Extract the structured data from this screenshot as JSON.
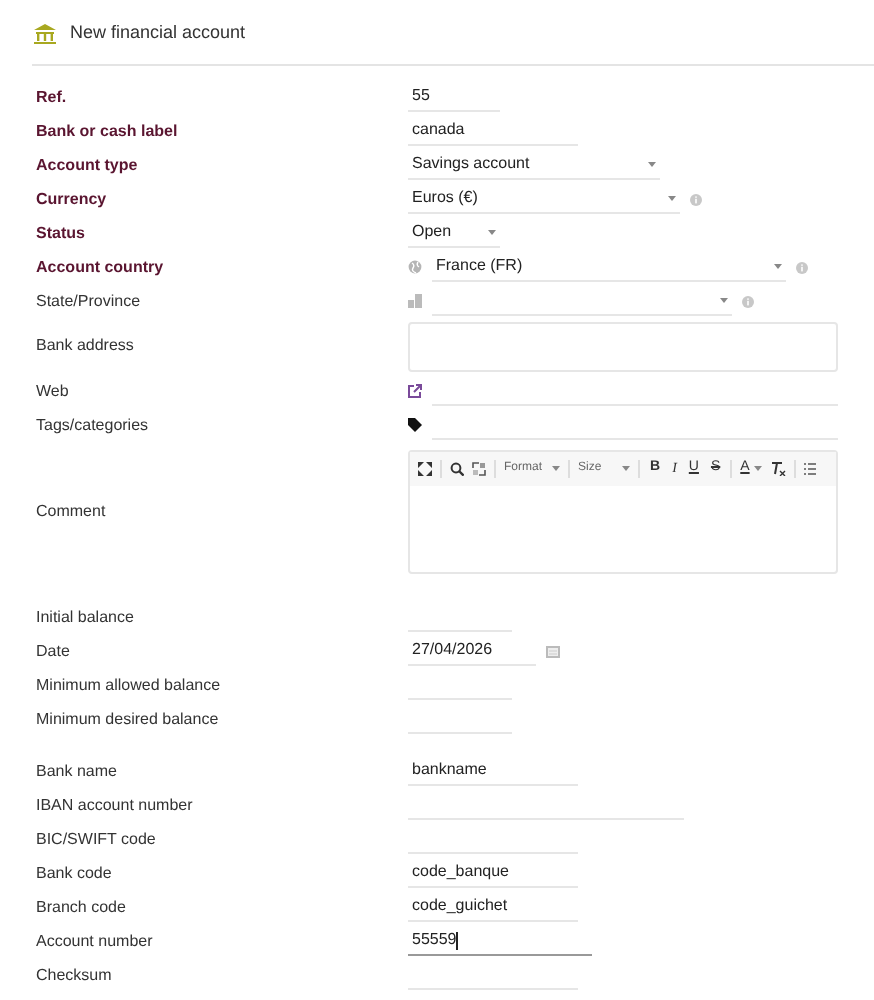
{
  "title": "New financial account",
  "sections": [
    {
      "rows": [
        {
          "label": "Ref.",
          "required": true,
          "kind": "text",
          "value": "55"
        },
        {
          "label": "Bank or cash label",
          "required": true,
          "kind": "text",
          "value": "canada"
        },
        {
          "label": "Account type",
          "required": true,
          "kind": "select",
          "value": "Savings account",
          "help": false
        },
        {
          "label": "Currency",
          "required": true,
          "kind": "select",
          "value": "Euros (€)",
          "help": true
        },
        {
          "label": "Status",
          "required": true,
          "kind": "select",
          "value": "Open",
          "help": false
        },
        {
          "label": "Account country",
          "required": true,
          "kind": "country",
          "value": "France (FR)",
          "help": true
        },
        {
          "label": "State/Province",
          "required": false,
          "kind": "state",
          "help": true
        },
        {
          "label": "Bank address",
          "required": false,
          "kind": "textarea"
        },
        {
          "label": "Web",
          "required": false,
          "kind": "url"
        },
        {
          "label": "Tags/categories",
          "required": false,
          "kind": "tags"
        },
        {
          "label": "Comment",
          "required": false,
          "kind": "editor",
          "toolbar": {
            "format": "Format",
            "size": "Size",
            "bold": "B",
            "italic": "I",
            "underline": "U",
            "strike": "S",
            "font_color": "A"
          }
        }
      ]
    },
    {
      "rows": [
        {
          "label": "Initial balance",
          "required": false,
          "kind": "text"
        },
        {
          "label": "Date",
          "required": false,
          "kind": "date",
          "value": "27/04/2026"
        },
        {
          "label": "Minimum allowed balance",
          "required": false,
          "kind": "text"
        },
        {
          "label": "Minimum desired balance",
          "required": false,
          "kind": "text"
        }
      ]
    },
    {
      "rows": [
        {
          "label": "Bank name",
          "required": false,
          "kind": "text",
          "value": "bankname"
        },
        {
          "label": "IBAN account number",
          "required": false,
          "kind": "text"
        },
        {
          "label": "BIC/SWIFT code",
          "required": false,
          "kind": "text"
        },
        {
          "label": "Bank code",
          "required": false,
          "kind": "text",
          "value": "code_banque"
        },
        {
          "label": "Branch code",
          "required": false,
          "kind": "text",
          "value": "code_guichet"
        },
        {
          "label": "Account number",
          "required": false,
          "kind": "text",
          "value": "55559",
          "focused": true
        },
        {
          "label": "Checksum",
          "required": false,
          "kind": "text"
        }
      ]
    }
  ]
}
